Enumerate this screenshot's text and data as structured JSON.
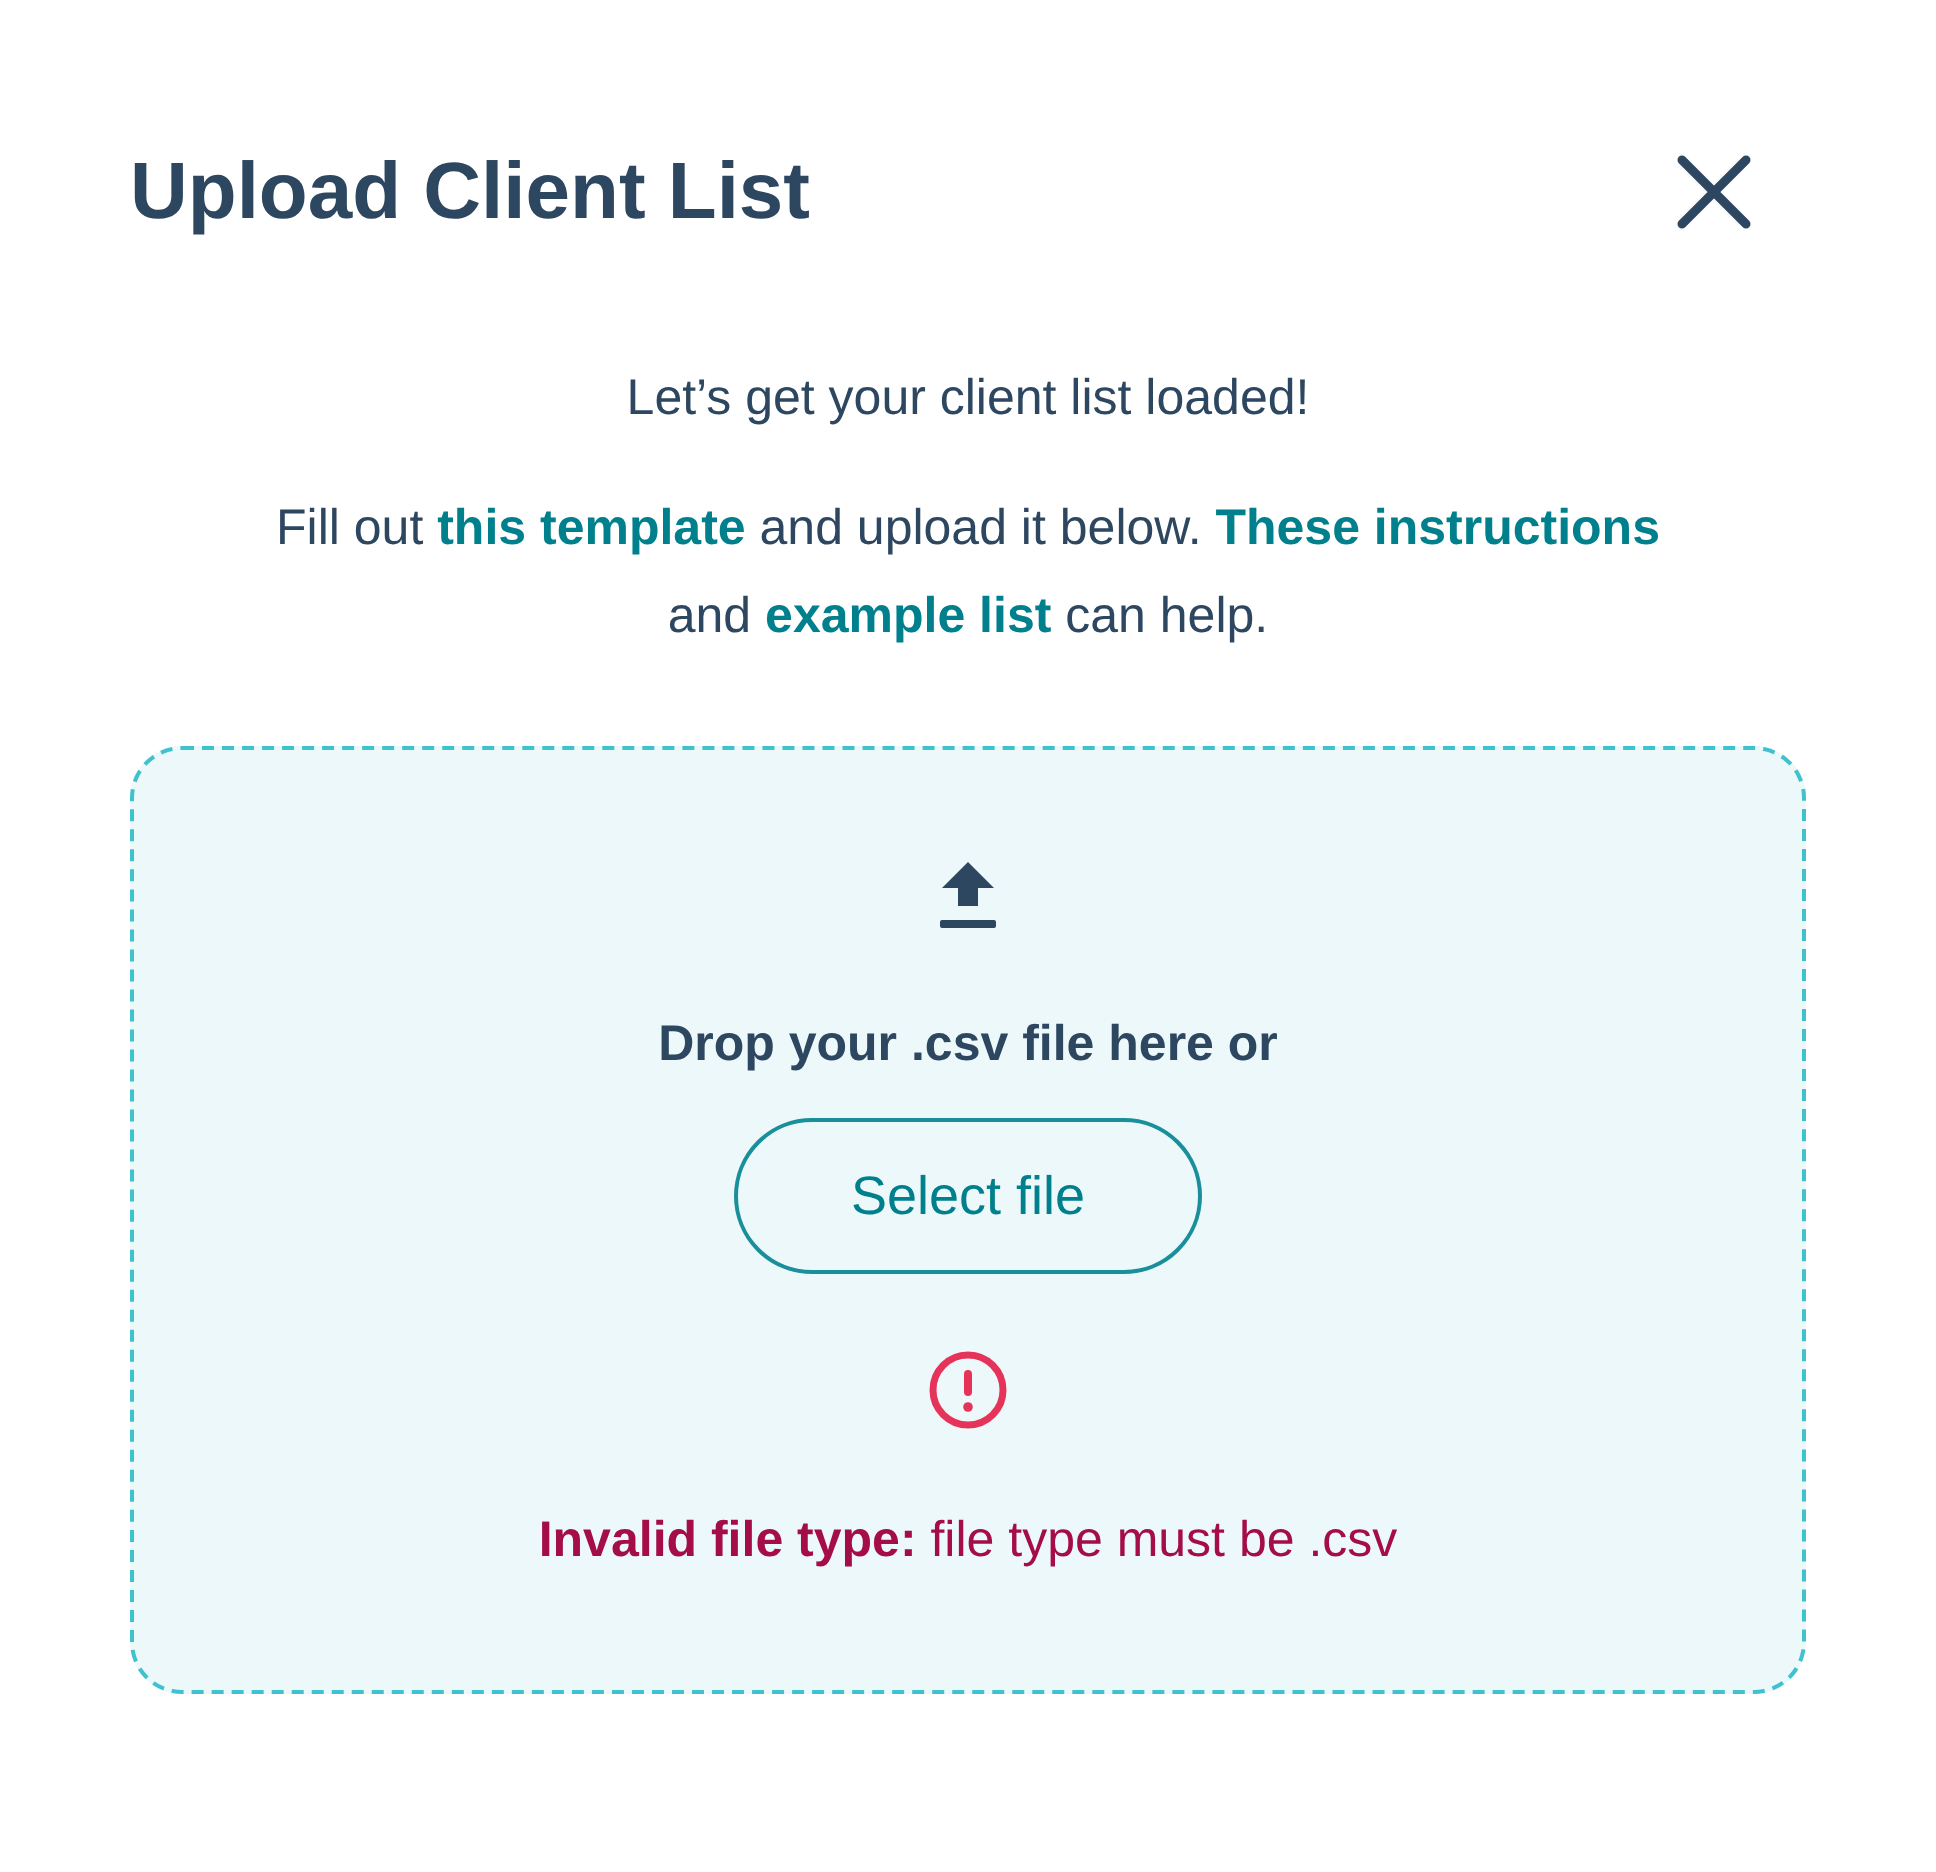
{
  "dialog": {
    "title": "Upload Client List"
  },
  "intro": "Let’s get your client list loaded!",
  "instructions": [
    {
      "kind": "text",
      "text": "Fill out "
    },
    {
      "kind": "link",
      "text": "this template"
    },
    {
      "kind": "text",
      "text": " and upload it below. "
    },
    {
      "kind": "link",
      "text": "These instructions"
    },
    {
      "kind": "text",
      "text": " and "
    },
    {
      "kind": "link",
      "text": "example list"
    },
    {
      "kind": "text",
      "text": " can help."
    }
  ],
  "dropzone": {
    "prompt": "Drop your .csv file here or",
    "button": "Select file",
    "error": "**Invalid file type:** file type must be .csv"
  }
}
